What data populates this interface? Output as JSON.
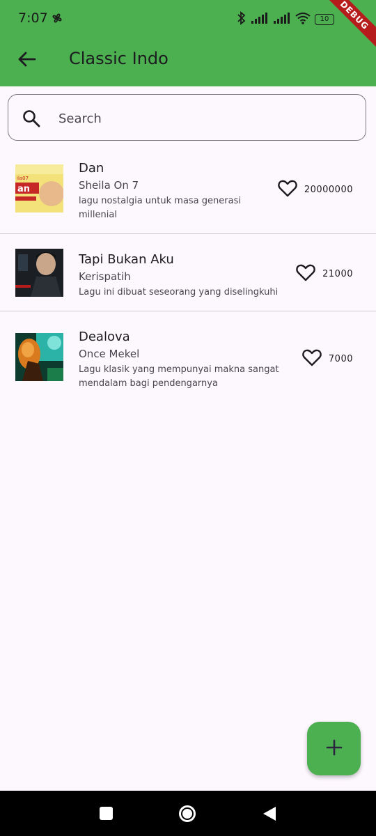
{
  "status_bar": {
    "time": "7:07",
    "battery": "10",
    "debug_label": "DEBUG"
  },
  "app_bar": {
    "title": "Classic Indo",
    "back_icon": "arrow-left-icon",
    "color": "#4caf50"
  },
  "search": {
    "placeholder": "Search",
    "icon": "search-icon"
  },
  "songs": [
    {
      "title": "Dan",
      "artist": "Sheila On 7",
      "description": "lagu nostalgia untuk masa generasi millenial",
      "likes": "20000000"
    },
    {
      "title": "Tapi Bukan Aku",
      "artist": "Kerispatih",
      "description": "Lagu ini dibuat seseorang yang diselingkuhi",
      "likes": "21000"
    },
    {
      "title": "Dealova",
      "artist": "Once Mekel",
      "description": "Lagu klasik yang mempunyai makna sangat mendalam bagi pendengarnya",
      "likes": "7000"
    }
  ],
  "fab": {
    "icon": "plus-icon"
  },
  "colors": {
    "accent": "#4caf50",
    "background": "#fdf7fe"
  }
}
